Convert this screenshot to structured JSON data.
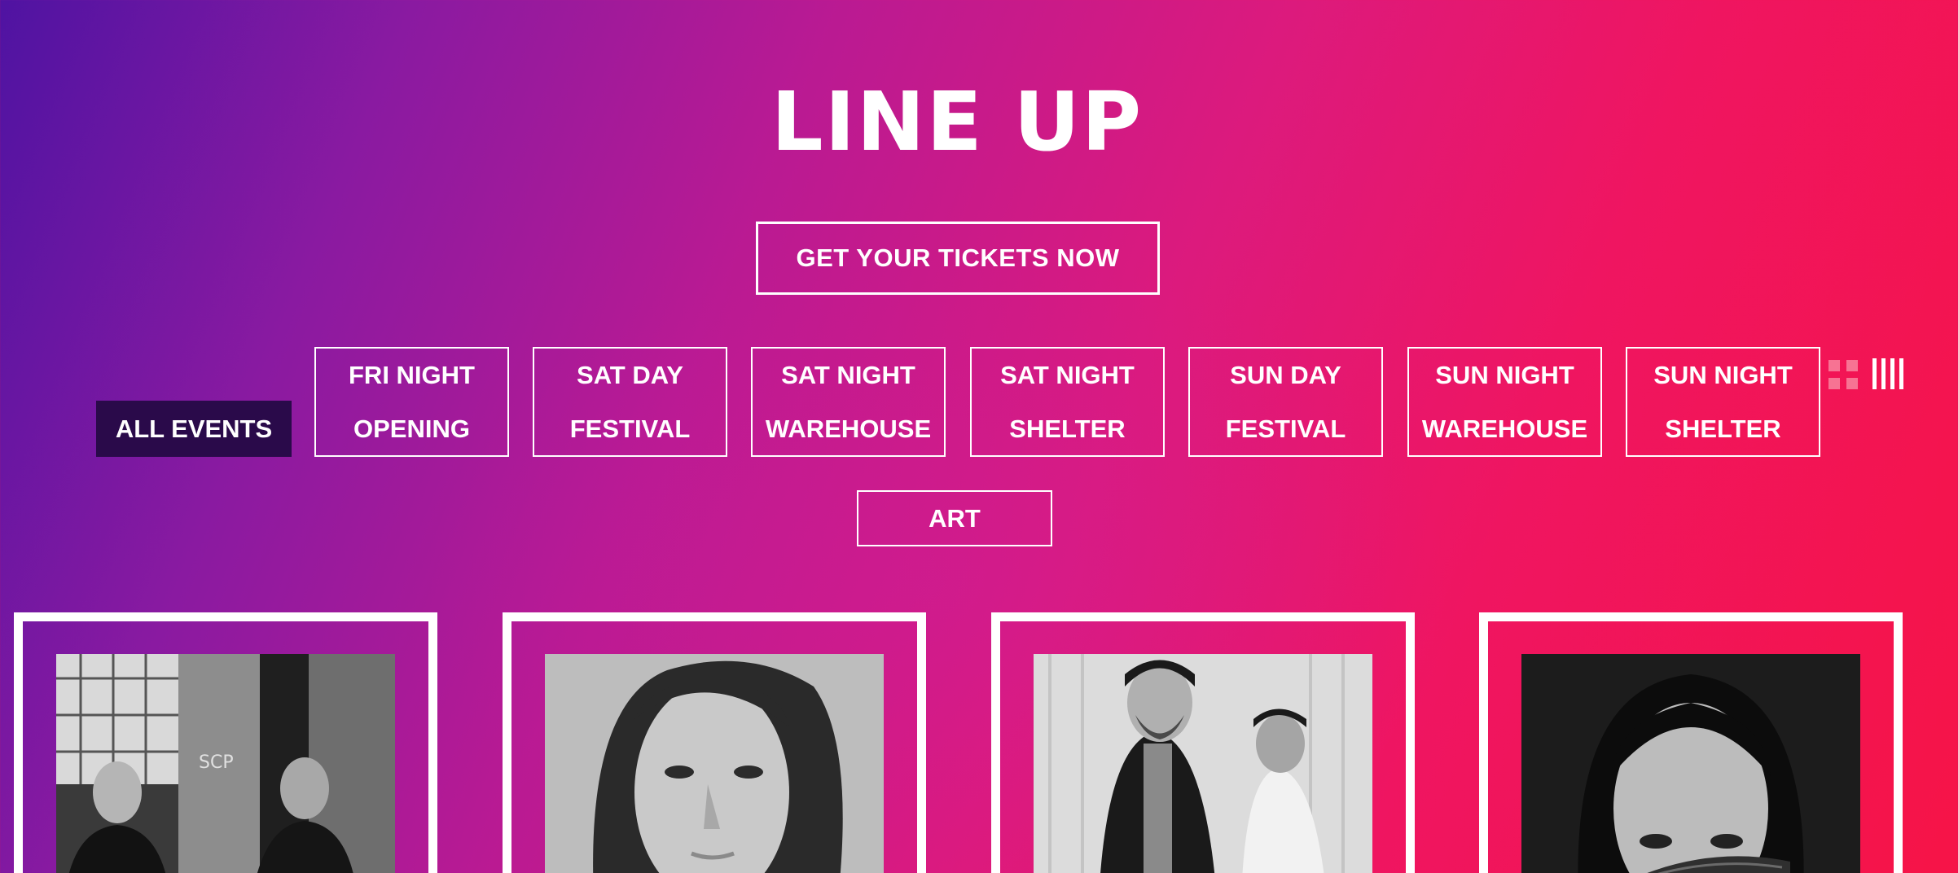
{
  "page": {
    "title": "LINE UP",
    "tickets_label": "GET YOUR TICKETS NOW"
  },
  "filters": {
    "all_events_label": "ALL EVENTS",
    "events": [
      {
        "line1": "FRI NIGHT",
        "line2": "OPENING"
      },
      {
        "line1": "SAT DAY",
        "line2": "FESTIVAL"
      },
      {
        "line1": "SAT NIGHT",
        "line2": "WAREHOUSE"
      },
      {
        "line1": "SAT NIGHT",
        "line2": "SHELTER"
      },
      {
        "line1": "SUN DAY",
        "line2": "FESTIVAL"
      },
      {
        "line1": "SUN NIGHT",
        "line2": "WAREHOUSE"
      },
      {
        "line1": "SUN NIGHT",
        "line2": "SHELTER"
      }
    ],
    "art_label": "ART"
  },
  "view_toggle": {
    "grid_icon": "grid-view-icon",
    "list_icon": "list-view-icon",
    "grid_color": "#f77393",
    "list_color": "#ffffff"
  },
  "artists": [
    {
      "photo": "duo-photo-industrial"
    },
    {
      "photo": "portrait-woman-long-hair"
    },
    {
      "photo": "duo-photo-beanie-caps"
    },
    {
      "photo": "portrait-woman-covered-face"
    }
  ],
  "colors": {
    "gradient_start": "#4f13a2",
    "gradient_end": "#f61447",
    "active_filter_bg": "#2a0a4a"
  }
}
